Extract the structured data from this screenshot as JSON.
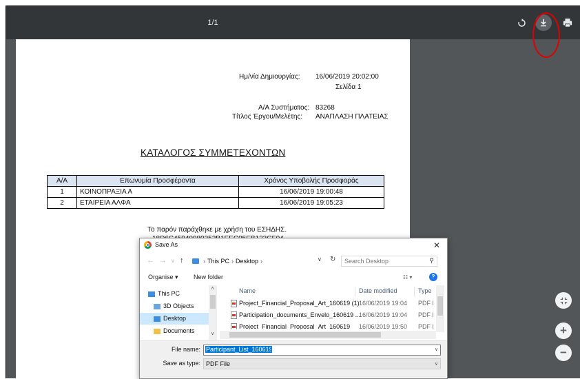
{
  "viewer": {
    "page_count": "1/1",
    "icons": {
      "rotate": "rotate-icon",
      "download": "download-icon",
      "print": "print-icon",
      "fit": "fit-page-icon",
      "zoom_in": "zoom-in-icon",
      "zoom_out": "zoom-out-icon"
    },
    "zoom_in_label": "+",
    "zoom_out_label": "−",
    "highlight_color": "#e00000"
  },
  "document": {
    "created_label": "Ημ/νία Δημιουργίας:",
    "created_value": "16/06/2019 20:02:00",
    "page_label": "Σελίδα 1",
    "system_no_label": "Α/Α Συστήματος:",
    "system_no_value": "83268",
    "project_label": "Τίτλος Έργου/Μελέτης:",
    "project_value": "ΑΝΑΠΛΑΣΗ ΠΛΑΤΕΙΑΣ",
    "title": "ΚΑΤΑΛΟΓΟΣ ΣΥΜΜΕΤΕΧΟΝΤΩΝ",
    "table": {
      "headers": [
        "Α/Α",
        "Επωνυμία Προσφέροντα",
        "Χρόνος Υποβολής Προσφοράς"
      ],
      "rows": [
        [
          "1",
          "ΚΟΙΝΟΠΡΑΞΙΑ Α",
          "16/06/2019 19:00:48"
        ],
        [
          "2",
          "ΕΤΑΙΡΕΙΑ ΑΛΦΑ",
          "16/06/2019 19:05:23"
        ]
      ]
    },
    "note": "Το παρόν παράχθηκε με χρήση του ΕΣΗΔΗΣ.",
    "hash": "18D6C45940980252B1EEC05EB123CF04"
  },
  "dialog": {
    "title": "Save As",
    "close": "✕",
    "nav_back": "←",
    "nav_forward": "→",
    "nav_recent": "∨",
    "nav_up": "↑",
    "breadcrumb": [
      "This PC",
      "Desktop"
    ],
    "search_placeholder": "Search Desktop",
    "organise": "Organise ▾",
    "new_folder": "New folder",
    "view_icon": "view-options-icon",
    "help": "?",
    "tree": [
      {
        "label": "This PC",
        "icon": "pc-icon",
        "color": "#3c8ee0"
      },
      {
        "label": "3D Objects",
        "icon": "3d-objects-icon",
        "color": "#6aa7e0"
      },
      {
        "label": "Desktop",
        "icon": "desktop-folder-icon",
        "color": "#3c8ee0"
      },
      {
        "label": "Documents",
        "icon": "documents-folder-icon",
        "color": "#f0c14b"
      }
    ],
    "columns": [
      "Name",
      "Date modified",
      "Type"
    ],
    "files": [
      {
        "name": "Project_Financial_Proposal_Art_160619 (1)",
        "date": "16/06/2019 19:04",
        "type": "PDF File"
      },
      {
        "name": "Participation_documents_Envelo_160619 ...",
        "date": "16/06/2019 19:04",
        "type": "PDF File"
      },
      {
        "name": "Project_Financial_Proposal_Art_160619",
        "date": "16/06/2019 19:50",
        "type": "PDF File"
      }
    ],
    "file_name_label": "File name:",
    "file_name_value": "Participant_List_160619",
    "save_type_label": "Save as type:",
    "save_type_value": "PDF File"
  }
}
